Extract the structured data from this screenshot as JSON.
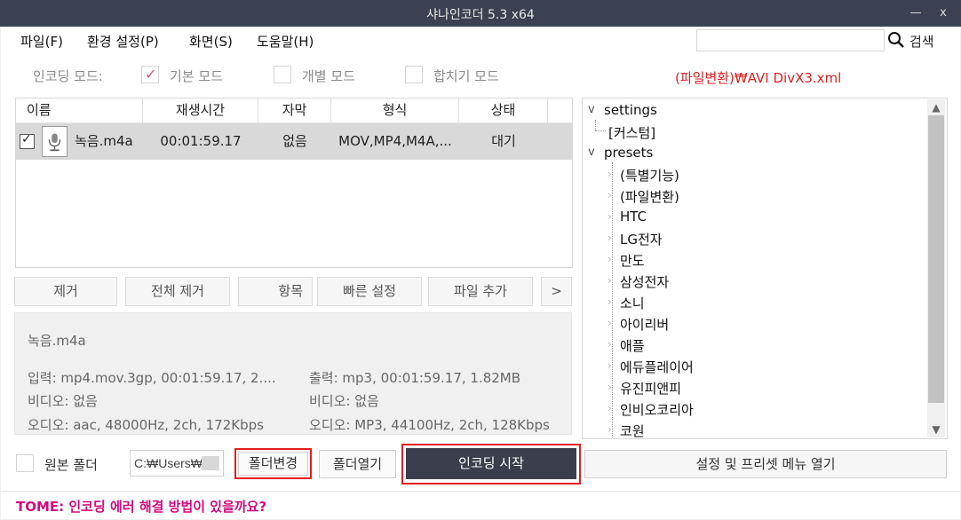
{
  "window": {
    "title": "샤나인코더  5.3  x64",
    "minimize": "—",
    "close": "x"
  },
  "menu": {
    "file": "파일(F)",
    "settings": "환경 설정(P)",
    "view": "화면(S)",
    "help": "도움말(H)"
  },
  "search": {
    "label": "검색",
    "value": ""
  },
  "encode_mode": {
    "label": "인코딩 모드:",
    "basic": "기본 모드",
    "basic_checked": true,
    "individual": "개별 모드",
    "individual_checked": false,
    "merge": "합치기 모드",
    "merge_checked": false
  },
  "preset_path": "(파일변환)₩AVI DivX3.xml",
  "file_list": {
    "columns": [
      "이름",
      "재생시간",
      "자막",
      "형식",
      "상태"
    ],
    "rows": [
      {
        "name": "녹음.m4a",
        "duration": "00:01:59.17",
        "subtitle": "없음",
        "format": "MOV,MP4,M4A,...",
        "status": "대기",
        "checked": true
      }
    ]
  },
  "list_buttons": {
    "remove": "제거",
    "remove_all": "전체 제거",
    "items": "항목",
    "quick_settings": "빠른 설정",
    "add_file": "파일 추가",
    "more": ">"
  },
  "info": {
    "file_name": "녹음.m4a",
    "input": "입력: mp4.mov.3gp, 00:01:59.17, 2....",
    "input_video": "비디오: 없음",
    "input_audio": "오디오: aac, 48000Hz, 2ch, 172Kbps",
    "output": "출력: mp3, 00:01:59.17, 1.82MB",
    "output_video": "비디오: 없음",
    "output_audio": "오디오: MP3, 44100Hz, 2ch, 128Kbps"
  },
  "tree": {
    "settings": "settings",
    "custom": "[커스텀]",
    "presets": "presets",
    "items": [
      "(특별기능)",
      "(파일변환)",
      "HTC",
      "LG전자",
      "만도",
      "삼성전자",
      "소니",
      "아이리버",
      "애플",
      "에듀플레이어",
      "유진피앤피",
      "인비오코리아",
      "코원"
    ]
  },
  "bottom": {
    "source_folder": "원본 폴더",
    "source_folder_checked": false,
    "output_path": "C:₩Users₩",
    "change_folder": "폴더변경",
    "open_folder": "폴더열기",
    "start_encoding": "인코딩 시작",
    "open_presets_menu": "설정 및 프리셋 메뉴 열기"
  },
  "status": {
    "tip": "TOME: 인코딩 에러 해결 방법이 있을까요?"
  },
  "colors": {
    "titlebar": "#3b4150",
    "accent_pink": "#e9497f",
    "highlight_red": "#e41e1e",
    "encode_button": "#3a3e4d",
    "tip": "#d40a7c",
    "preset_path": "#e02020"
  }
}
